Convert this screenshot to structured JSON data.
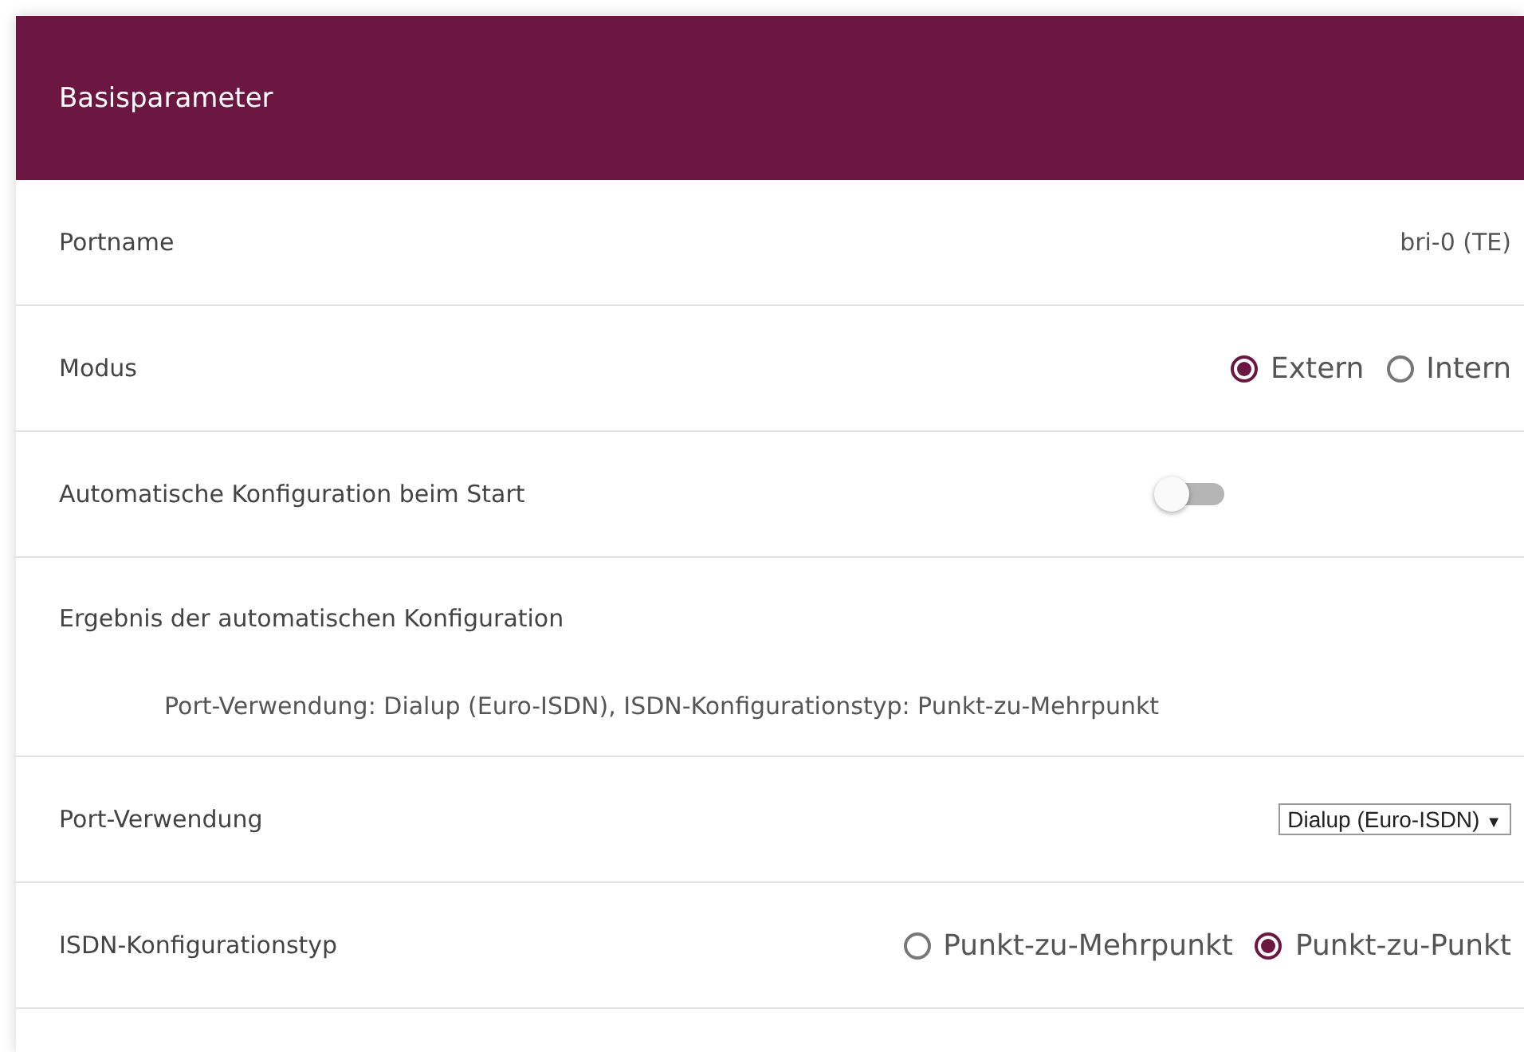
{
  "panel": {
    "title": "Basisparameter"
  },
  "rows": [
    {
      "kind": "text",
      "label": "Portname",
      "value": "bri-0 (TE)"
    },
    {
      "kind": "radio",
      "label": "Modus",
      "options": [
        {
          "label": "Extern",
          "selected": true
        },
        {
          "label": "Intern",
          "selected": false
        }
      ]
    },
    {
      "kind": "toggle",
      "label": "Automatische Konfiguration beim Start",
      "on": false
    },
    {
      "kind": "result",
      "label": "Ergebnis der automatischen Konfiguration",
      "value": "Port-Verwendung: Dialup (Euro-ISDN), ISDN-Konfigurationstyp: Punkt-zu-Mehrpunkt"
    },
    {
      "kind": "select",
      "label": "Port-Verwendung",
      "value": "Dialup (Euro-ISDN)",
      "arrow": "▼"
    },
    {
      "kind": "radio",
      "label": "ISDN-Konfigurationstyp",
      "options": [
        {
          "label": "Punkt-zu-Mehrpunkt",
          "selected": false
        },
        {
          "label": "Punkt-zu-Punkt",
          "selected": true
        }
      ]
    }
  ]
}
